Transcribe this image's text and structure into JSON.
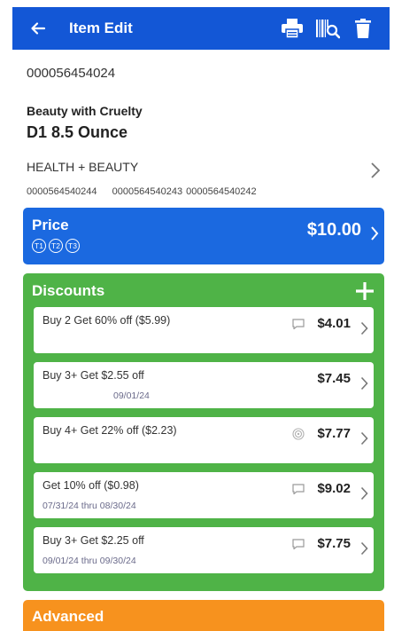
{
  "appbar": {
    "title": "Item Edit",
    "back_icon": "arrow-left-icon",
    "actions": [
      "printer-icon",
      "barcode-scan-icon",
      "trash-icon"
    ]
  },
  "item": {
    "upc": "000056454024",
    "brand": "Beauty with Cruelty",
    "description": "D1 8.5 Ounce",
    "department": "HEALTH + BEAUTY",
    "alt_codes": [
      "0000564540244",
      "0000564540243",
      "0000564540242"
    ]
  },
  "price": {
    "label": "Price",
    "amount": "$10.00",
    "tiers": [
      "T1",
      "T2",
      "T3"
    ],
    "color": "#1b69e0"
  },
  "discounts": {
    "label": "Discounts",
    "color": "#4fb347",
    "items": [
      {
        "title": "Buy 2 Get 60% off ($5.99)",
        "subtitle": "",
        "amount": "$4.01",
        "icon": "message-icon"
      },
      {
        "title": "Buy 3+ Get $2.55 off",
        "subtitle": "09/01/24",
        "amount": "$7.45",
        "icon": ""
      },
      {
        "title": "Buy 4+ Get 22% off ($2.23)",
        "subtitle": "",
        "amount": "$7.77",
        "icon": "target-icon"
      },
      {
        "title": "Get 10% off ($0.98)",
        "subtitle": "07/31/24 thru 08/30/24",
        "amount": "$9.02",
        "icon": "message-icon"
      },
      {
        "title": "Buy 3+ Get $2.25 off",
        "subtitle": "09/01/24 thru 09/30/24",
        "amount": "$7.75",
        "icon": "message-icon"
      }
    ]
  },
  "advanced": {
    "label": "Advanced",
    "color": "#f7921e"
  }
}
